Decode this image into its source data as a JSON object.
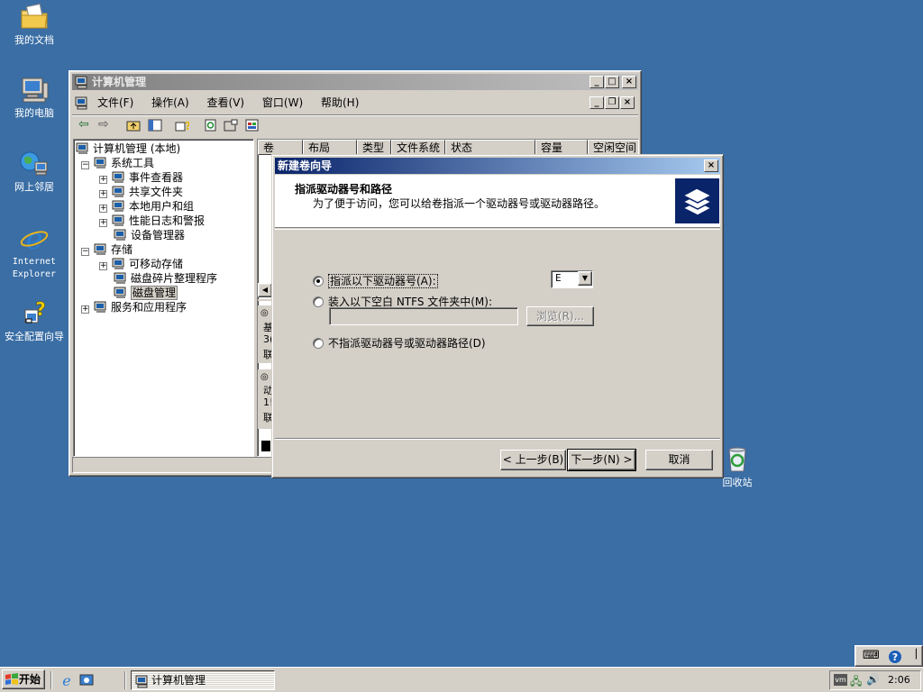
{
  "desktop": {
    "icons": [
      {
        "label": "我的文档",
        "icon": "folder-documents-icon"
      },
      {
        "label": "我的电脑",
        "icon": "computer-icon"
      },
      {
        "label": "网上邻居",
        "icon": "network-icon"
      },
      {
        "label": "Internet Explorer",
        "icon": "internet-explorer-icon"
      },
      {
        "label": "安全配置向导",
        "icon": "security-wizard-icon"
      },
      {
        "label": "回收站",
        "icon": "recycle-bin-icon"
      }
    ]
  },
  "main_window": {
    "title": "计算机管理",
    "menu": [
      "文件(F)",
      "操作(A)",
      "查看(V)",
      "窗口(W)",
      "帮助(H)"
    ],
    "tree": [
      {
        "label": "计算机管理 (本地)",
        "level": 0,
        "expander": ""
      },
      {
        "label": "系统工具",
        "level": 1,
        "expander": "−"
      },
      {
        "label": "事件查看器",
        "level": 2,
        "expander": "+"
      },
      {
        "label": "共享文件夹",
        "level": 2,
        "expander": "+"
      },
      {
        "label": "本地用户和组",
        "level": 2,
        "expander": "+"
      },
      {
        "label": "性能日志和警报",
        "level": 2,
        "expander": "+"
      },
      {
        "label": "设备管理器",
        "level": 2,
        "expander": ""
      },
      {
        "label": "存储",
        "level": 1,
        "expander": "−"
      },
      {
        "label": "可移动存储",
        "level": 2,
        "expander": "+"
      },
      {
        "label": "磁盘碎片整理程序",
        "level": 2,
        "expander": ""
      },
      {
        "label": "磁盘管理",
        "level": 2,
        "expander": "",
        "selected": true
      },
      {
        "label": "服务和应用程序",
        "level": 1,
        "expander": "+"
      }
    ],
    "columns": [
      "卷",
      "布局",
      "类型",
      "文件系统",
      "状态",
      "容量",
      "空闲空间"
    ],
    "fragments": [
      "基",
      "3(",
      "联",
      "动",
      "1!",
      "联"
    ]
  },
  "wizard": {
    "title": "新建卷向导",
    "heading": "指派驱动器号和路径",
    "subheading": "为了便于访问，您可以给卷指派一个驱动器号或驱动器路径。",
    "option_assign": "指派以下驱动器号(A):",
    "drive_letter": "E",
    "option_mount": "装入以下空白 NTFS 文件夹中(M):",
    "mount_path": "",
    "browse": "浏览(R)...",
    "option_none": "不指派驱动器号或驱动器路径(D)",
    "back": "< 上一步(B)",
    "next": "下一步(N) >",
    "cancel": "取消"
  },
  "taskbar": {
    "start": "开始",
    "task": "计算机管理",
    "clock": "2:06",
    "tray_icons": [
      "vmware-icon",
      "network-connection-icon",
      "volume-icon"
    ]
  }
}
